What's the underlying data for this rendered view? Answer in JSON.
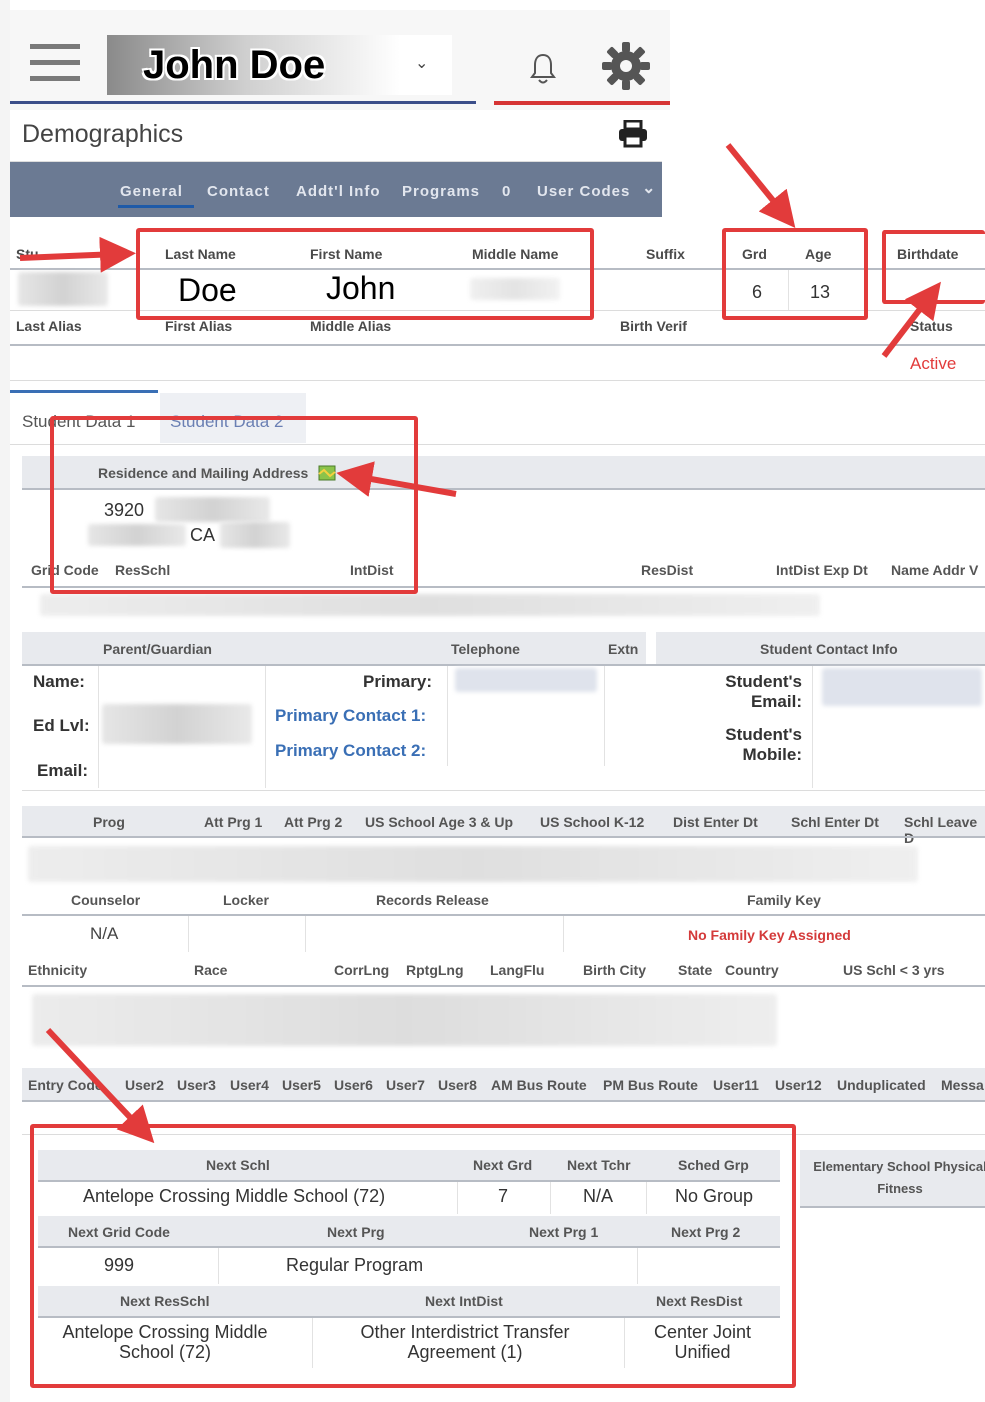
{
  "header": {
    "student_name": "John Doe",
    "menu_icon": "hamburger-icon",
    "dropdown_icon": "chevron-down-icon",
    "bell_icon": "bell-icon",
    "gear_icon": "gear-icon"
  },
  "page": {
    "title": "Demographics",
    "print_icon": "printer-icon",
    "tabs": [
      "General",
      "Contact",
      "Addt'l Info",
      "Programs",
      "User Codes"
    ],
    "programs_badge": "0"
  },
  "student": {
    "headers": {
      "student": "Stu",
      "last_name": "Last Name",
      "first_name": "First Name",
      "middle_name": "Middle Name",
      "suffix": "Suffix",
      "grd": "Grd",
      "age": "Age",
      "birthdate": "Birthdate"
    },
    "values": {
      "last_name": "Doe",
      "first_name": "John",
      "grd": "6",
      "age": "13"
    },
    "alias_headers": {
      "last_alias": "Last Alias",
      "first_alias": "First Alias",
      "middle_alias": "Middle Alias",
      "birth_verif": "Birth Verif",
      "status": "Status"
    },
    "status_value": "Active"
  },
  "subtabs": [
    "Student Data 1",
    "Student Data 2"
  ],
  "address": {
    "title": "Residence and Mailing Address",
    "map_icon": "map-icon",
    "line1": "3920",
    "state": "CA",
    "headers": [
      "Grid Code",
      "ResSchl",
      "IntDist",
      "ResDist",
      "IntDist Exp Dt",
      "Name Addr V"
    ]
  },
  "parent": {
    "headers": {
      "parent": "Parent/Guardian",
      "telephone": "Telephone",
      "extn": "Extn",
      "contact_info": "Student Contact Info"
    },
    "name": "Name:",
    "ed_lvl": "Ed Lvl:",
    "email": "Email:",
    "primary": "Primary:",
    "primary_contact_1": "Primary Contact 1:",
    "primary_contact_2": "Primary Contact 2:",
    "student_email": "Student's Email:",
    "student_mobile": "Student's Mobile:"
  },
  "programs_row": {
    "headers": [
      "Prog",
      "Att Prg 1",
      "Att Prg 2",
      "US School Age 3 & Up",
      "US School K-12",
      "Dist Enter Dt",
      "Schl Enter Dt",
      "Schl Leave D"
    ]
  },
  "counselor_row": {
    "headers": [
      "Counselor",
      "Locker",
      "Records Release",
      "Family Key"
    ],
    "counselor": "N/A",
    "family_key": "No Family Key Assigned"
  },
  "ethnicity_row": {
    "headers": [
      "Ethnicity",
      "Race",
      "CorrLng",
      "RptgLng",
      "LangFlu",
      "Birth City",
      "State",
      "Country",
      "US Schl < 3 yrs"
    ]
  },
  "user_row": {
    "headers": [
      "Entry Code",
      "User2",
      "User3",
      "User4",
      "User5",
      "User6",
      "User7",
      "User8",
      "AM Bus Route",
      "PM Bus Route",
      "User11",
      "User12",
      "Unduplicated",
      "Messa"
    ]
  },
  "next_year": {
    "h1": [
      "Next Schl",
      "Next Grd",
      "Next Tchr",
      "Sched Grp"
    ],
    "v1": [
      "Antelope Crossing Middle School (72)",
      "7",
      "N/A",
      "No Group"
    ],
    "h2": [
      "Next Grid Code",
      "Next Prg",
      "Next Prg 1",
      "Next Prg 2"
    ],
    "v2": [
      "999",
      "Regular Program"
    ],
    "h3": [
      "Next ResSchl",
      "Next IntDist",
      "Next ResDist"
    ],
    "v3": [
      "Antelope Crossing Middle School (72)",
      "Other Interdistrict Transfer Agreement (1)",
      "Center Joint Unified"
    ],
    "side_header": "Elementary School Physical Fitness"
  },
  "colors": {
    "accent_red": "#e23b3b",
    "tab_bar": "#6b7a93",
    "link": "#3a6fb5",
    "status": "#e23b3b"
  }
}
